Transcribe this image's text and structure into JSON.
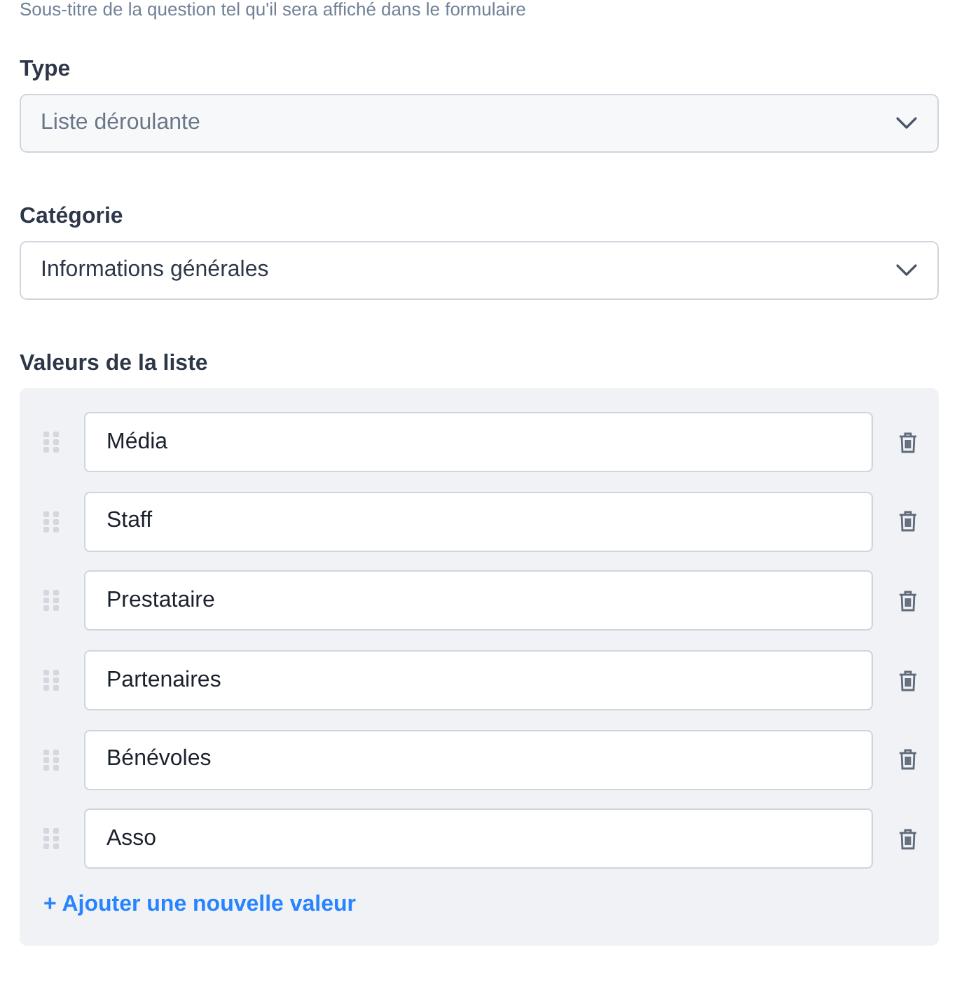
{
  "subtitle": "Sous-titre de la question tel qu'il sera affiché dans le formulaire",
  "fields": [
    {
      "label": "Type",
      "value": "Liste déroulante",
      "disabled": true
    },
    {
      "label": "Catégorie",
      "value": "Informations générales",
      "disabled": false
    }
  ],
  "list": {
    "label": "Valeurs de la liste",
    "values": [
      "Média",
      "Staff",
      "Prestataire",
      "Partenaires",
      "Bénévoles",
      "Asso"
    ],
    "add_link": "+ Ajouter une nouvelle valeur"
  }
}
